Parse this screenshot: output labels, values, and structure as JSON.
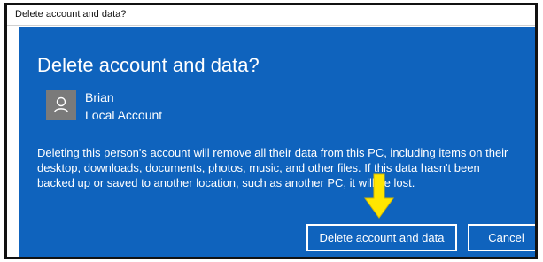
{
  "window": {
    "title": "Delete account and data?"
  },
  "dialog": {
    "heading": "Delete account and data?",
    "user": {
      "name": "Brian",
      "account_type": "Local Account",
      "avatar_icon": "person-icon"
    },
    "message": "Deleting this person's account will remove all their data from this PC, including items on their desktop, downloads, documents, photos, music, and other files. If this data hasn't been backed up or saved to another location, such as another PC, it will be lost.",
    "buttons": {
      "delete_label": "Delete account and data",
      "cancel_label": "Cancel"
    }
  },
  "annotation": {
    "arrow_icon": "down-arrow-icon",
    "arrow_color": "#ffe600"
  },
  "colors": {
    "dialog_background": "#0f63bd",
    "text": "#ffffff",
    "avatar_background": "#7a7a7a"
  }
}
